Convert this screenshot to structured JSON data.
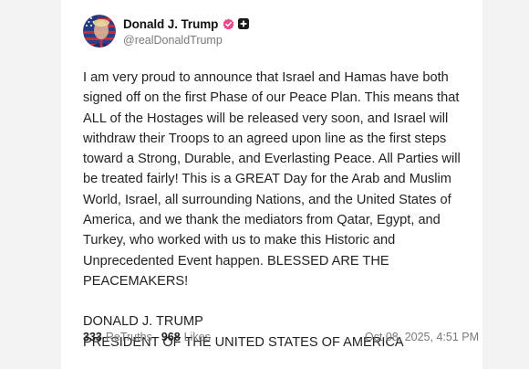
{
  "author": {
    "display_name": "Donald J. Trump",
    "handle": "@realDonaldTrump",
    "avatar_icon": "flag-portrait-avatar",
    "verified_icon": "verified-badge-icon",
    "verified_color": "#e64a8b",
    "plus_icon": "add-icon"
  },
  "post": {
    "body": "I am very proud to announce that Israel and Hamas have both signed off on the first Phase of our Peace Plan. This means that ALL of the Hostages will be released very soon, and Israel will withdraw their Troops to an agreed upon line as the first steps toward a Strong, Durable, and Everlasting Peace. All Parties will be treated fairly! This is a GREAT Day for the Arab and Muslim World, Israel, all surrounding Nations, and the United States of America, and we thank the mediators from Qatar, Egypt, and Turkey, who worked with us to make this Historic and Unprecedented Event happen. BLESSED ARE THE PEACEMAKERS!",
    "signature_line1": "DONALD J. TRUMP",
    "signature_line2": "PRESIDENT OF THE UNITED STATES OF AMERICA"
  },
  "stats": {
    "retruths_count": "333",
    "retruths_label": "ReTruths",
    "likes_count": "968",
    "likes_label": "Likes",
    "timestamp": "Oct 08, 2025, 4:51 PM"
  }
}
